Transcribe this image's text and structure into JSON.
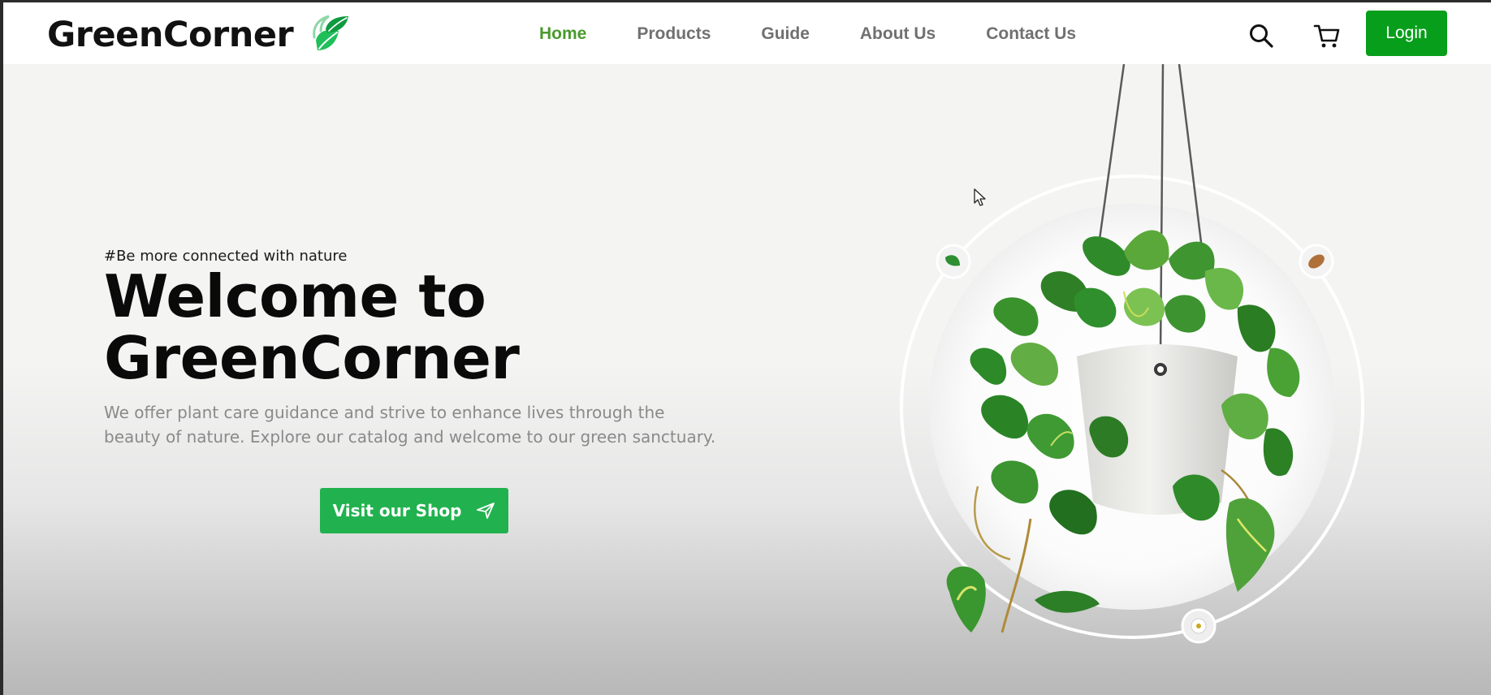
{
  "brand": {
    "name": "GreenCorner"
  },
  "nav": {
    "items": [
      {
        "label": "Home",
        "active": true
      },
      {
        "label": "Products",
        "active": false
      },
      {
        "label": "Guide",
        "active": false
      },
      {
        "label": "About Us",
        "active": false
      },
      {
        "label": "Contact Us",
        "active": false
      }
    ],
    "search_icon": "search-icon",
    "cart_icon": "cart-icon",
    "login_label": "Login"
  },
  "hero": {
    "tagline": "#Be more connected with nature",
    "title_line1": "Welcome to",
    "title_line2": "GreenCorner",
    "description_line1": "We offer plant care guidance and strive to enhance lives through the",
    "description_line2": "beauty of nature. Explore our catalog and welcome to our green sanctuary.",
    "shop_button_label": "Visit our Shop",
    "shop_button_icon": "send-icon"
  },
  "colors": {
    "accent_green": "#069e1a",
    "nav_active": "#4a9a2c",
    "shop_button": "#21b24f"
  }
}
